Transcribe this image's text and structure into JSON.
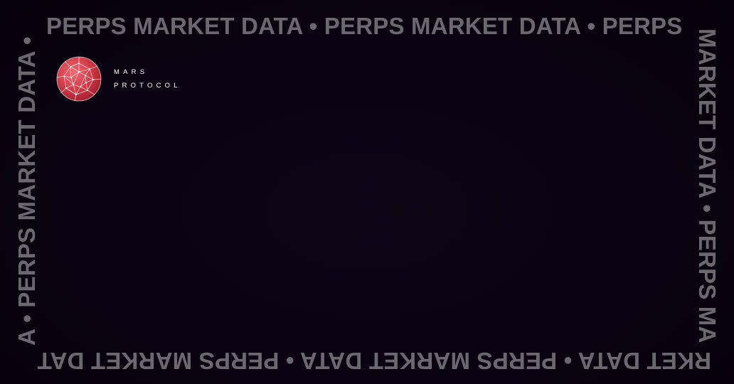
{
  "brand": {
    "line1": "MARS",
    "line2": "PROTOCOL",
    "accent_color": "#d43a48",
    "icon": "geodesic-sphere-icon"
  },
  "border_text": {
    "top": "PERPS MARKET DATA • PERPS MARKET DATA • PERPS",
    "right": "MARKET DATA • PERPS MA",
    "bottom": "RKET DATA • PERPS MARKET DATA • PERPS MARKET DAT",
    "left": "A • PERPS MARKET DATA •"
  },
  "colors": {
    "background": "#0a0210",
    "border_text": "#6b6870"
  }
}
